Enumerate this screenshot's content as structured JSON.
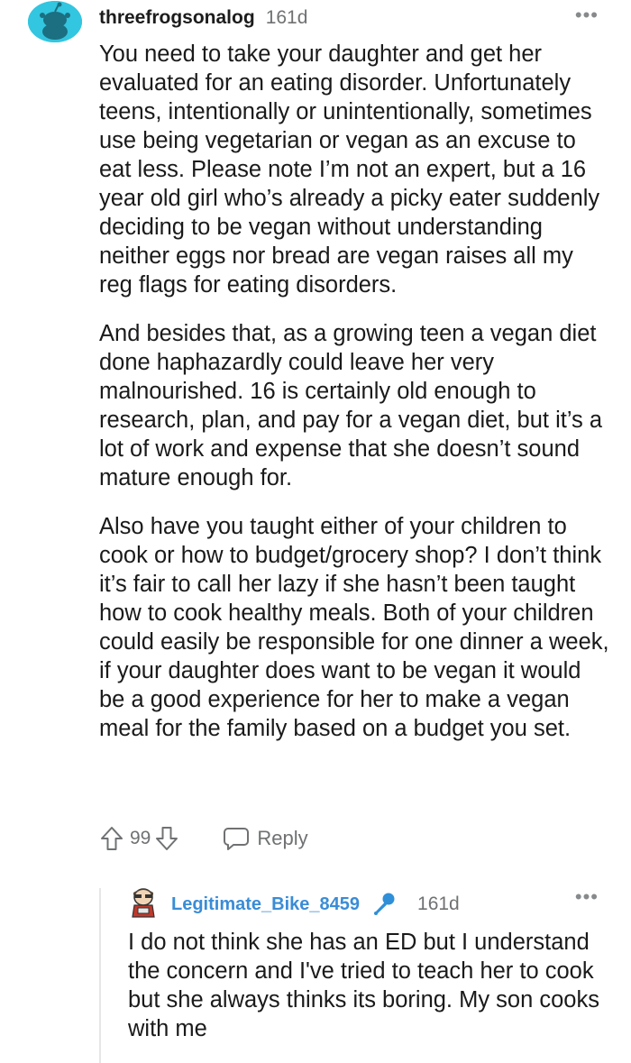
{
  "comment": {
    "username": "threefrogsonalog",
    "age": "161d",
    "more_label": "•••",
    "paragraphs": [
      "You need to take your daughter and get her evaluated for an eating disorder. Unfortunately teens, intentionally or unintentionally, sometimes use being vegetarian or vegan as an excuse to eat less. Please note I’m not an expert, but a 16 year old girl who’s already a picky eater suddenly deciding to be vegan without understanding neither eggs nor bread are vegan raises all my reg flags for eating disorders.",
      "And besides that, as a growing teen a vegan diet done haphazardly could leave her very malnourished. 16 is certainly old enough to research, plan, and pay for a vegan diet, but it’s a lot of work and expense that she doesn’t sound mature enough for.",
      "Also have you taught either of your children to cook or how to budget/grocery shop? I don’t think it’s fair to call her lazy if she hasn’t been taught how to cook healthy meals. Both of your children could easily be responsible for one dinner a week, if your daughter does want to be vegan it would be a good experience for her to make a vegan meal for the family based on a budget you set."
    ],
    "score": "99",
    "reply_label": "Reply",
    "avatar_icon": "snoo-avatar-icon",
    "avatar_color": "#33c6e0"
  },
  "reply": {
    "username": "Legitimate_Bike_8459",
    "badge_icon": "microphone-icon",
    "age": "161d",
    "more_label": "•••",
    "body": "I do not think she has an ED but I understand the concern and I've tried to teach her to cook but she always thinks its boring. My son cooks with me",
    "username_color": "#3a8cd6"
  }
}
